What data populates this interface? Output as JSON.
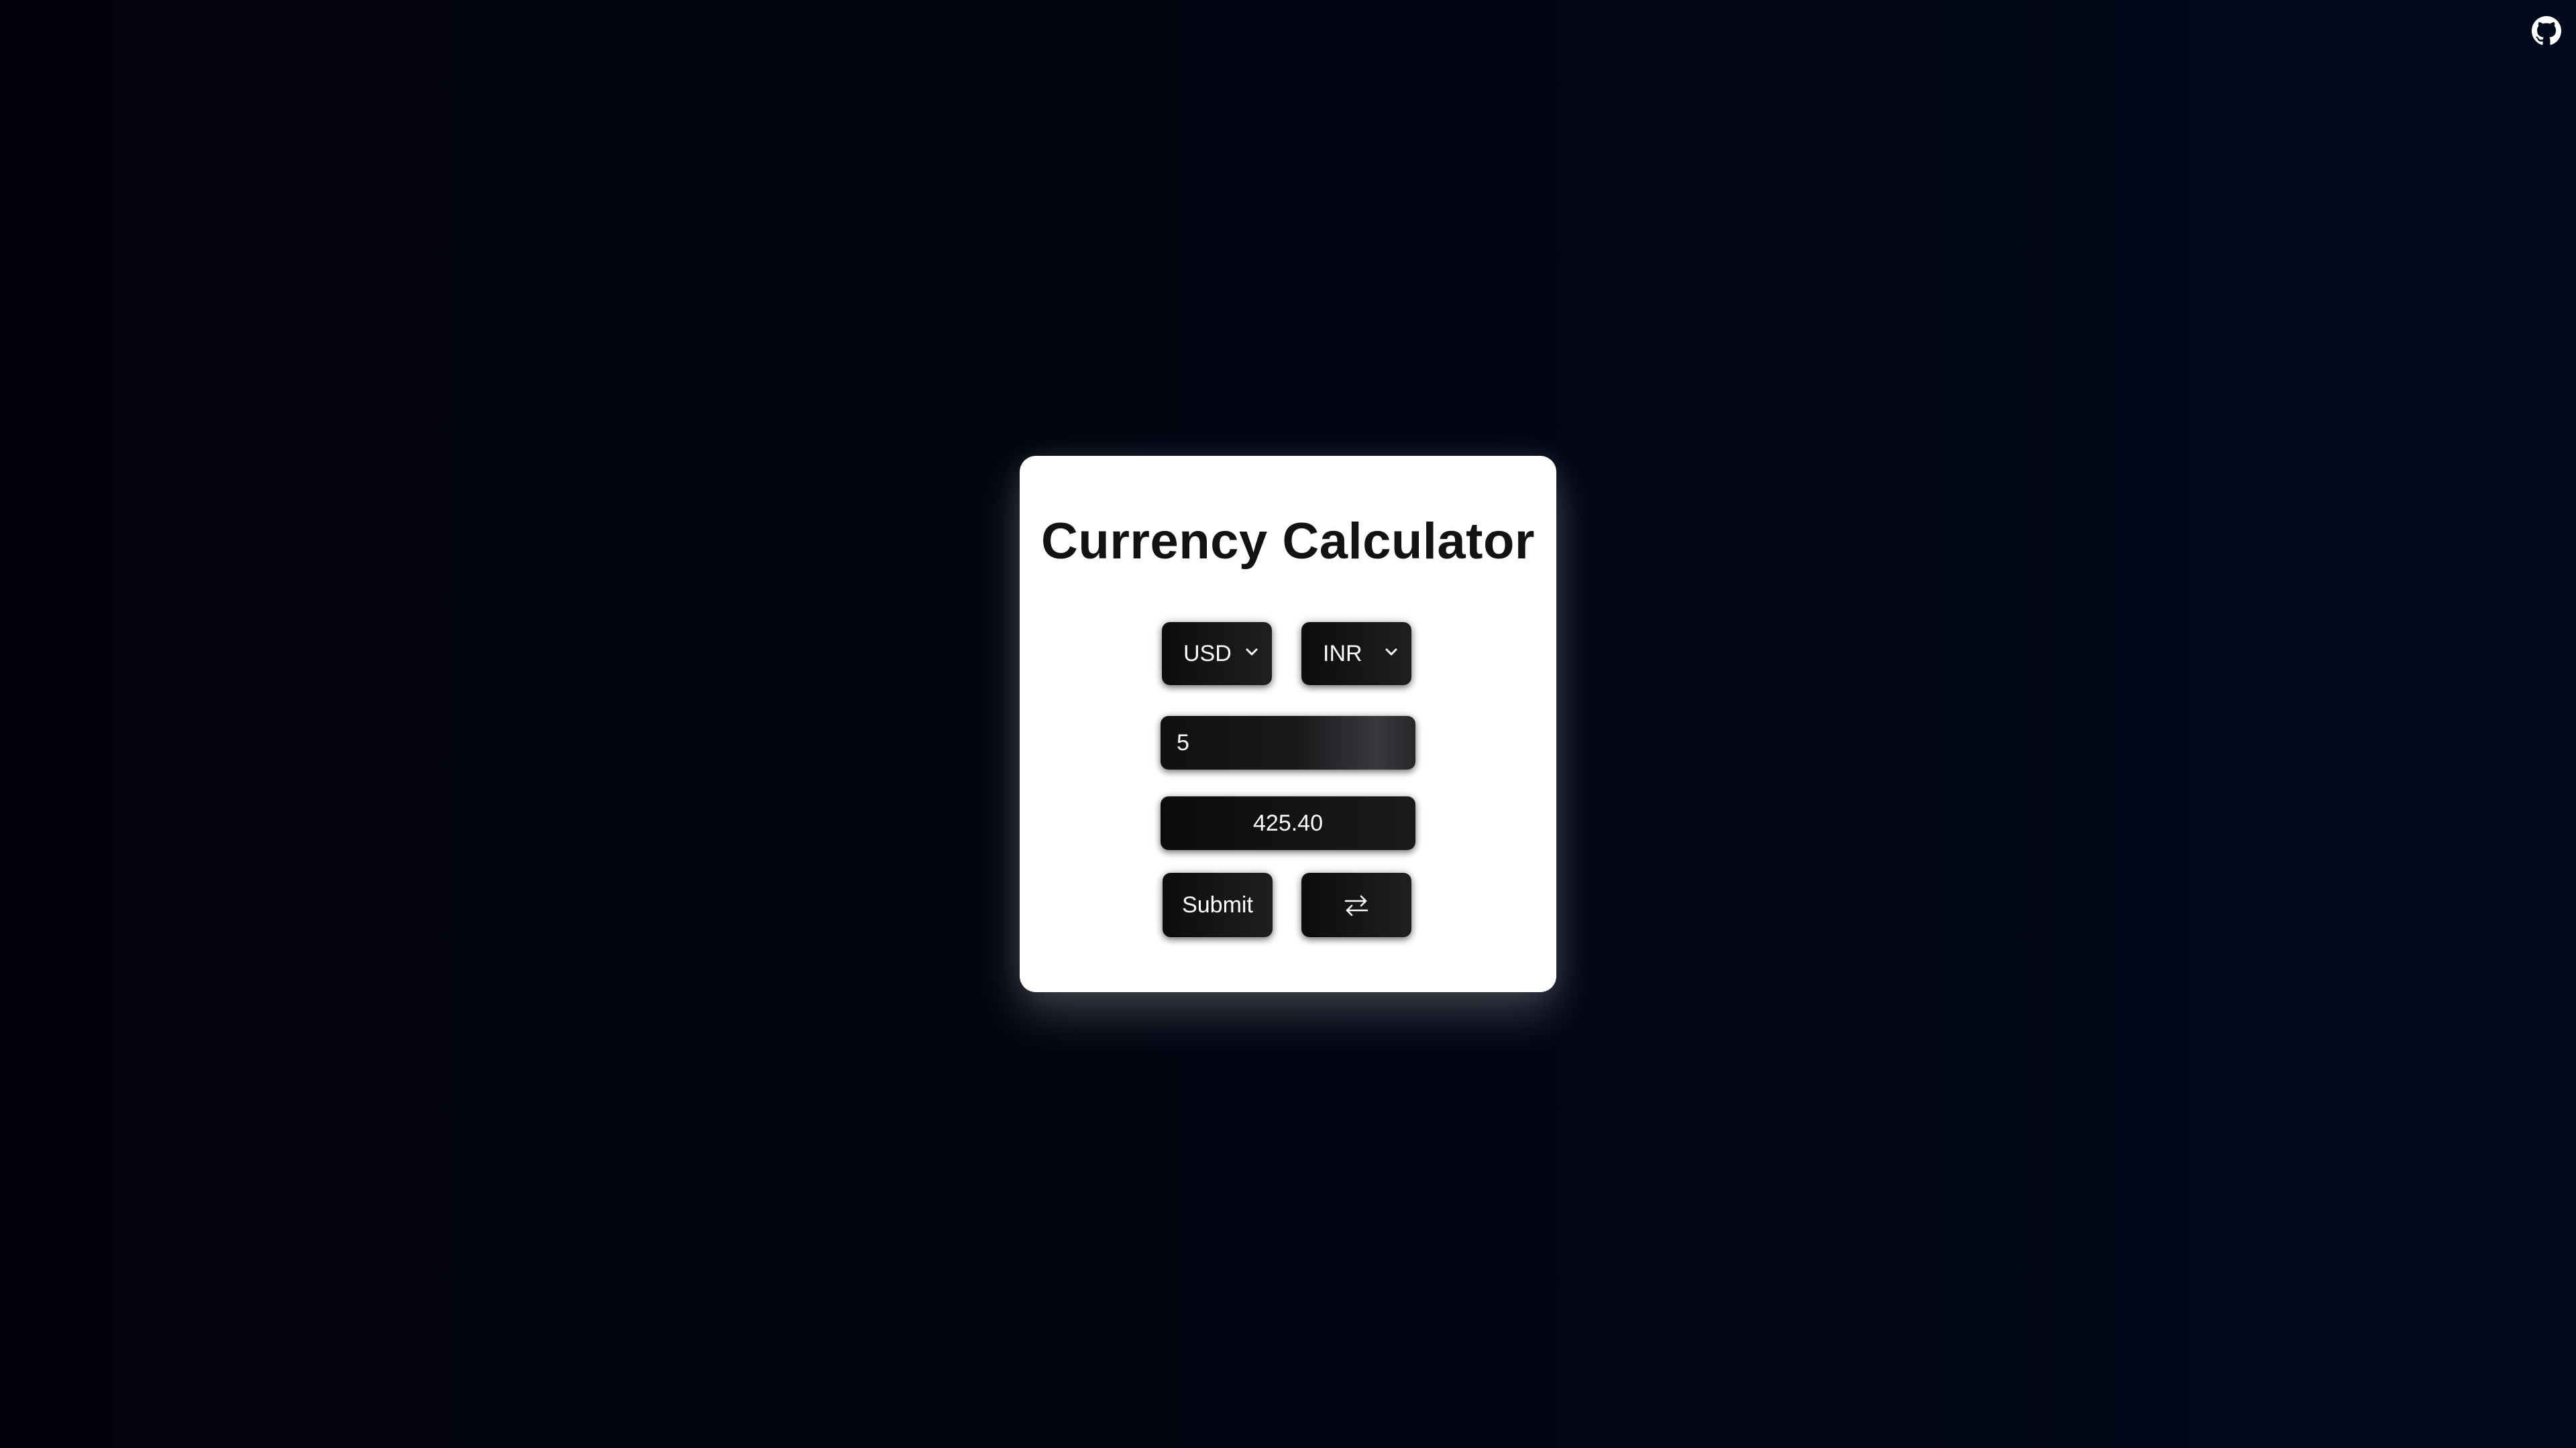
{
  "header": {
    "github_icon": "github-icon"
  },
  "converter": {
    "title": "Currency Calculator",
    "from_currency": "USD",
    "to_currency": "INR",
    "amount_value": "5",
    "result_value": "425.40",
    "submit_label": "Submit",
    "swap_icon": "swap-arrows-icon"
  },
  "colors": {
    "background": "#020412",
    "card": "#ffffff",
    "control": "#141416",
    "text_on_control": "#ffffff",
    "title": "#121212"
  }
}
